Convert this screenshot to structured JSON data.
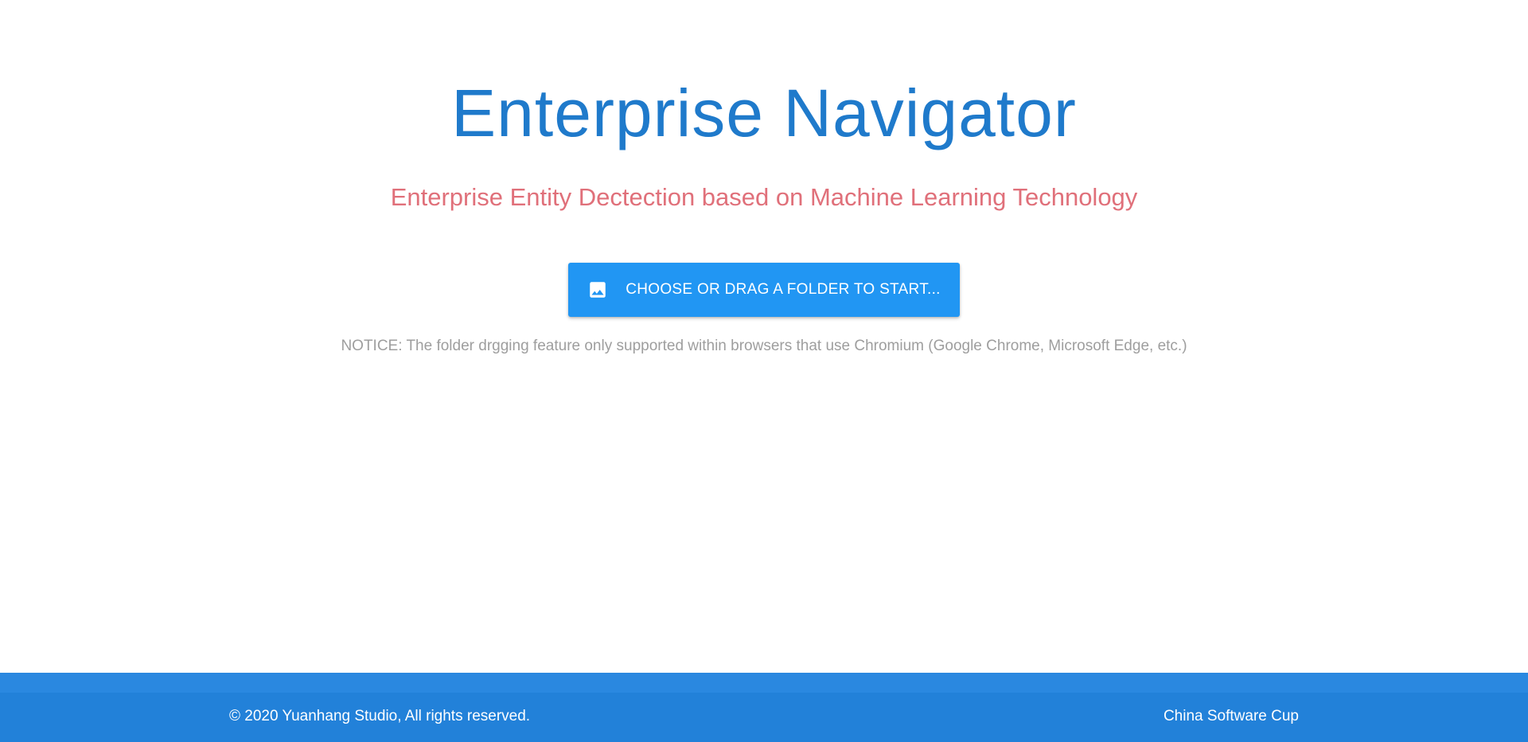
{
  "hero": {
    "title": "Enterprise Navigator",
    "subtitle": "Enterprise Entity Dectection based on Machine Learning Technology"
  },
  "start_button": {
    "label": "CHOOSE OR DRAG A FOLDER TO START...",
    "icon": "image-icon"
  },
  "notice": "NOTICE: The folder drgging feature only supported within browsers that use Chromium (Google Chrome, Microsoft Edge, etc.)",
  "footer": {
    "copyright": "© 2020 Yuanhang Studio, All rights reserved.",
    "link_label": "China Software Cup"
  },
  "colors": {
    "title": "#1f7acb",
    "subtitle": "#e0707a",
    "button": "#2196f3",
    "footer": "#2281d9",
    "notice": "#9e9e9e"
  }
}
